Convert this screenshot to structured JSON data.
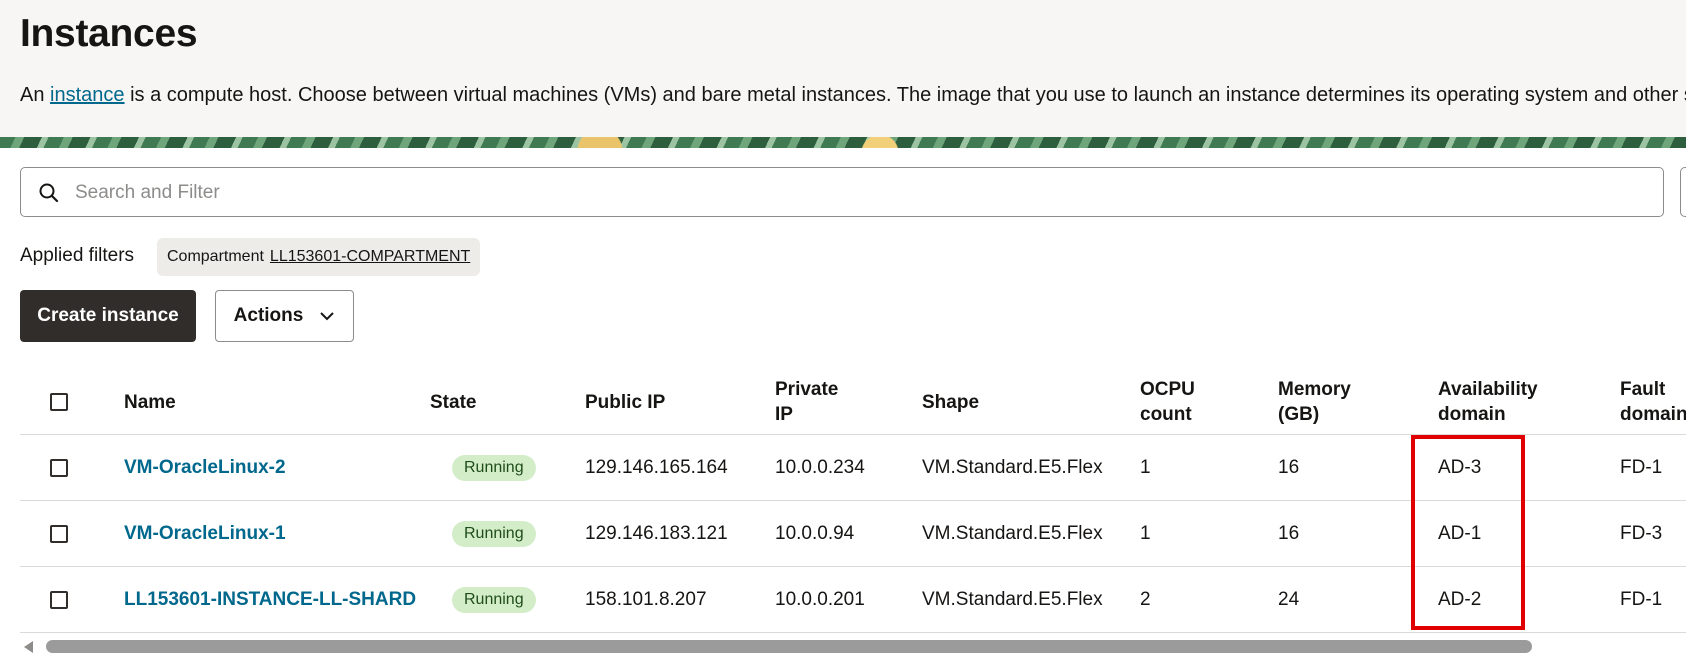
{
  "header": {
    "title": "Instances",
    "description_prefix": "An",
    "description_link": "instance",
    "description_rest": "is a compute host. Choose between virtual machines (VMs) and bare metal instances. The image that you use to launch an instance determines its operating system and other software"
  },
  "search": {
    "placeholder": "Search and Filter",
    "value": ""
  },
  "filters": {
    "label": "Applied filters",
    "chip_key": "Compartment",
    "chip_value": "LL153601-COMPARTMENT"
  },
  "toolbar": {
    "create_label": "Create instance",
    "actions_label": "Actions"
  },
  "table": {
    "columns": [
      "Name",
      "State",
      "Public IP",
      "Private IP",
      "Shape",
      "OCPU count",
      "Memory (GB)",
      "Availability domain",
      "Fault domain"
    ],
    "rows": [
      {
        "name": "VM-OracleLinux-2",
        "state": "Running",
        "public_ip": "129.146.165.164",
        "private_ip": "10.0.0.234",
        "shape": "VM.Standard.E5.Flex",
        "ocpu": "1",
        "memory": "16",
        "ad": "AD-3",
        "fd": "FD-1"
      },
      {
        "name": "VM-OracleLinux-1",
        "state": "Running",
        "public_ip": "129.146.183.121",
        "private_ip": "10.0.0.94",
        "shape": "VM.Standard.E5.Flex",
        "ocpu": "1",
        "memory": "16",
        "ad": "AD-1",
        "fd": "FD-3"
      },
      {
        "name": "LL153601-INSTANCE-LL-SHARD",
        "state": "Running",
        "public_ip": "158.101.8.207",
        "private_ip": "10.0.0.201",
        "shape": "VM.Standard.E5.Flex",
        "ocpu": "2",
        "memory": "24",
        "ad": "AD-2",
        "fd": "FD-1"
      }
    ]
  },
  "colors": {
    "link": "#00688c",
    "primary_button": "#312d2a",
    "running_badge": "#d4edc9",
    "highlight": "#e00000"
  },
  "icons": [
    "search-icon",
    "chevron-down-icon",
    "scroll-left-arrow-icon"
  ]
}
